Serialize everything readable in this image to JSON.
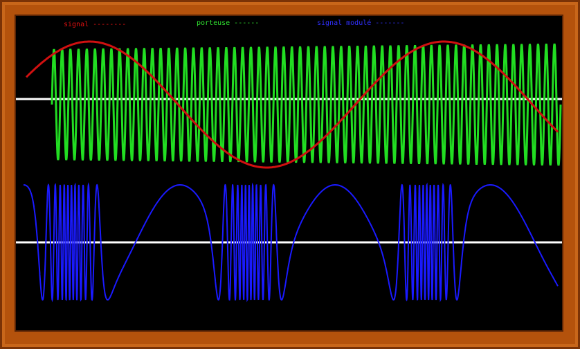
{
  "chart_data": {
    "type": "line",
    "legend": [
      {
        "name": "signal --------",
        "color": "#e01010"
      },
      {
        "name": "porteuse ------",
        "color": "#30e030"
      },
      {
        "name": "signal modulé -------",
        "color": "#3030ff"
      }
    ],
    "panels": [
      "top",
      "bottom"
    ],
    "series": [
      {
        "name": "signal",
        "panel": "top",
        "color": "#d01010",
        "waveform": "sine",
        "cycles": 1.5,
        "amplitude": 1.0
      },
      {
        "name": "porteuse",
        "panel": "top",
        "color": "#22dd22",
        "waveform": "sine",
        "cycles": 62,
        "amplitude": 1.0
      },
      {
        "name": "signal modulé",
        "panel": "bottom",
        "color": "#1a1aff",
        "waveform": "frequency-modulated sine",
        "cycles_min": 3,
        "cycles_max": 40
      }
    ],
    "grid": false,
    "legend_position": "top",
    "colors": {
      "frame": "#b4520c",
      "background": "#000000",
      "axis": "#ffffff"
    }
  }
}
